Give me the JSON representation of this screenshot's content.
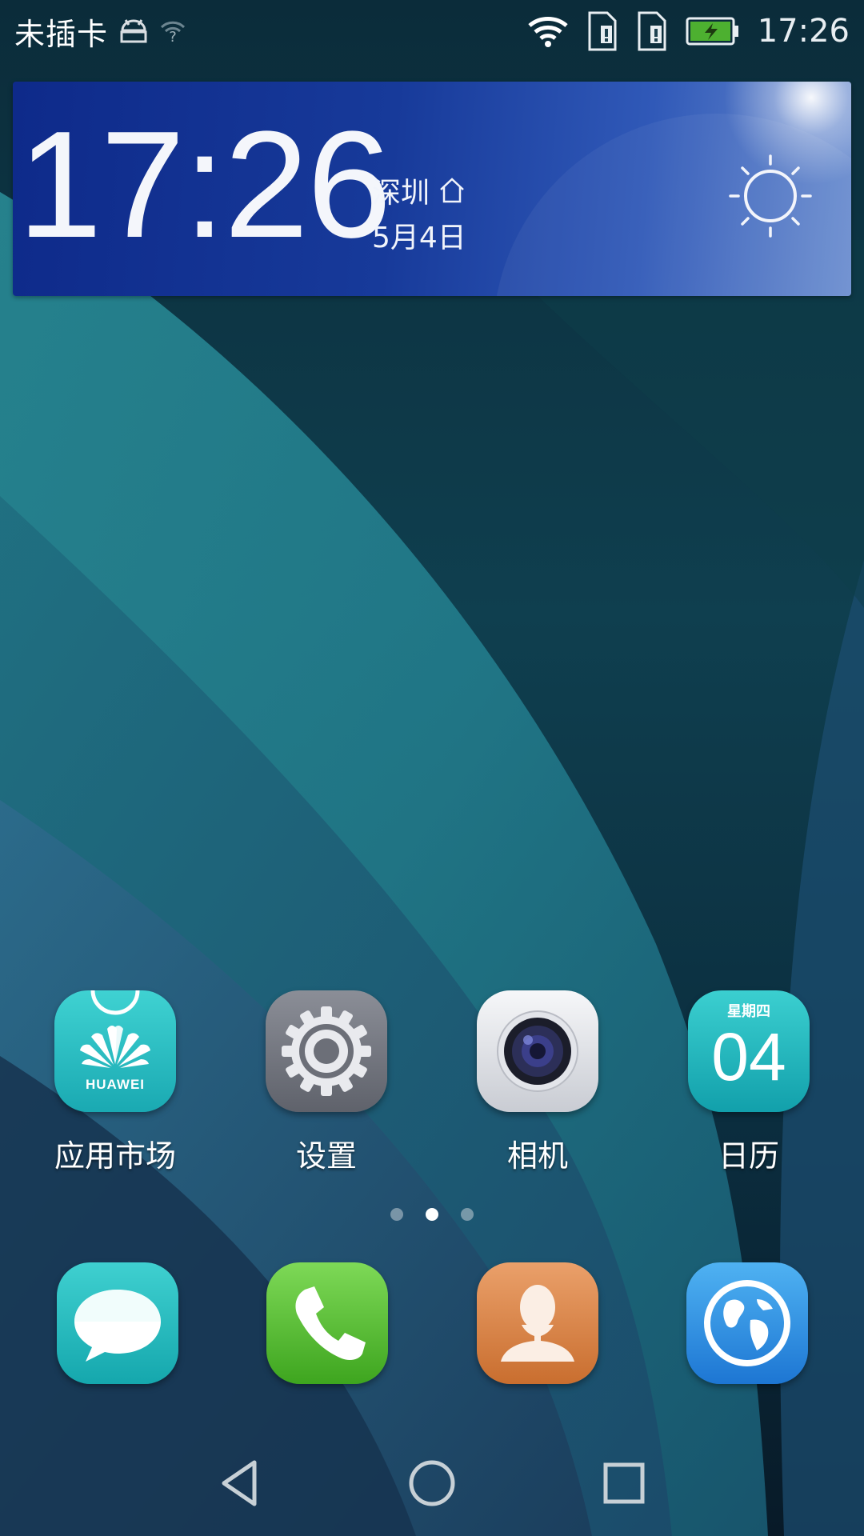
{
  "status_bar": {
    "carrier": "未插卡",
    "time": "17:26"
  },
  "widget": {
    "time": "17:26",
    "city": "深圳",
    "date": "5月4日",
    "weather_icon": "sun-icon"
  },
  "apps": [
    {
      "label": "应用市场",
      "icon": "huawei-appgallery-icon",
      "icon_text": "HUAWEI"
    },
    {
      "label": "设置",
      "icon": "gear-icon"
    },
    {
      "label": "相机",
      "icon": "camera-icon"
    },
    {
      "label": "日历",
      "icon": "calendar-icon",
      "weekday": "星期四",
      "day": "04"
    }
  ],
  "page_indicator": {
    "pages": 3,
    "active": 2
  },
  "dock": [
    {
      "name": "messages",
      "icon": "chat-bubble-icon"
    },
    {
      "name": "phone",
      "icon": "phone-icon"
    },
    {
      "name": "contacts",
      "icon": "person-icon"
    },
    {
      "name": "browser",
      "icon": "globe-icon"
    }
  ],
  "nav_bar": {
    "buttons": [
      "back",
      "home",
      "recents"
    ]
  },
  "colors": {
    "widget_bg": "#173a9a",
    "app_market": "#1aa9b2",
    "settings": "#5f626b",
    "phone": "#3ea51f",
    "contacts": "#c96e2f",
    "browser": "#1d76d3"
  }
}
